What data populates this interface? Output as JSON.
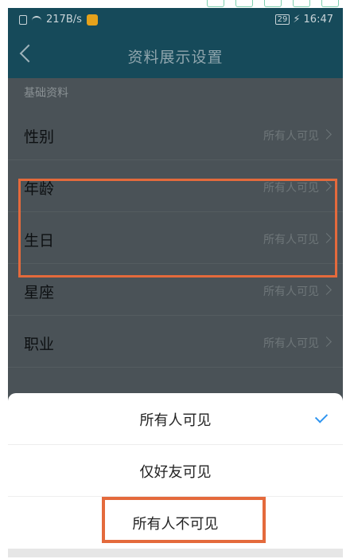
{
  "status_bar": {
    "speed": "217B/s",
    "battery": "29",
    "time": "16:47"
  },
  "nav": {
    "title": "资料展示设置"
  },
  "section": {
    "header": "基础资料"
  },
  "rows": [
    {
      "label": "性别",
      "value": "所有人可见"
    },
    {
      "label": "年龄",
      "value": "所有人可见"
    },
    {
      "label": "生日",
      "value": "所有人可见"
    },
    {
      "label": "星座",
      "value": "所有人可见"
    },
    {
      "label": "职业",
      "value": "所有人可见"
    }
  ],
  "sheet": {
    "options": [
      {
        "label": "所有人可见",
        "selected": true
      },
      {
        "label": "仅好友可见",
        "selected": false
      },
      {
        "label": "所有人不可见",
        "selected": false
      }
    ]
  },
  "colors": {
    "highlight": "#e46a3c",
    "check": "#2f95f0",
    "nav_bg": "#164a5a"
  }
}
